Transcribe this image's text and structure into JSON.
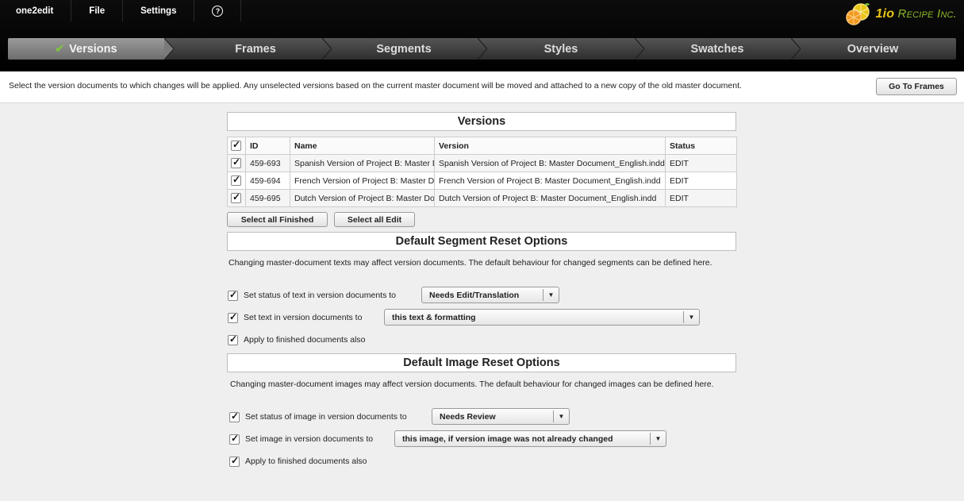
{
  "menu": {
    "app": "one2edit",
    "file": "File",
    "settings": "Settings",
    "help_icon": "?"
  },
  "logo": {
    "brand_main": "1io",
    "brand_rest": " Recipe Inc.",
    "icon": "orange-slices-logo-icon"
  },
  "steps": [
    {
      "label": "Versions",
      "active": true
    },
    {
      "label": "Frames"
    },
    {
      "label": "Segments"
    },
    {
      "label": "Styles"
    },
    {
      "label": "Swatches"
    },
    {
      "label": "Overview"
    }
  ],
  "info": {
    "text": "Select the version documents to which changes will be applied. Any unselected versions based on the current master document will be moved and attached to a new copy of the old master document.",
    "go_button": "Go To Frames"
  },
  "versions": {
    "title": "Versions",
    "columns": [
      "ID",
      "Name",
      "Version",
      "Status"
    ],
    "rows": [
      {
        "id": "459-693",
        "name": "Spanish Version of Project B: Master Document_English",
        "version": "Spanish Version of Project B: Master Document_English.indd",
        "status": "EDIT"
      },
      {
        "id": "459-694",
        "name": "French Version of Project B: Master Document_English",
        "version": "French Version of Project B: Master Document_English.indd",
        "status": "EDIT"
      },
      {
        "id": "459-695",
        "name": "Dutch Version of Project B: Master Document_English",
        "version": "Dutch Version of Project B: Master Document_English.indd",
        "status": "EDIT"
      }
    ],
    "select_finished": "Select all Finished",
    "select_edit": "Select all Edit"
  },
  "segment_reset": {
    "title": "Default Segment Reset Options",
    "desc": "Changing master-document texts may affect version documents. The default behaviour for changed segments can be defined here.",
    "status_label": "Set status of text in version documents to",
    "status_value": "Needs Edit/Translation",
    "text_label": "Set text in version documents to",
    "text_value": "this text & formatting",
    "finished_label": "Apply to finished documents also"
  },
  "image_reset": {
    "title": "Default Image Reset Options",
    "desc": "Changing master-document images may affect version documents. The default behaviour for changed images can be defined here.",
    "status_label": "Set status of image in version documents to",
    "status_value": "Needs Review",
    "image_label": "Set image in version documents to",
    "image_value": "this image, if version image was not already changed",
    "finished_label": "Apply to finished documents also"
  },
  "colors": {
    "check_accent": "#7dc242",
    "logo_yellow": "#e9c514",
    "logo_green": "#8fb82a"
  }
}
